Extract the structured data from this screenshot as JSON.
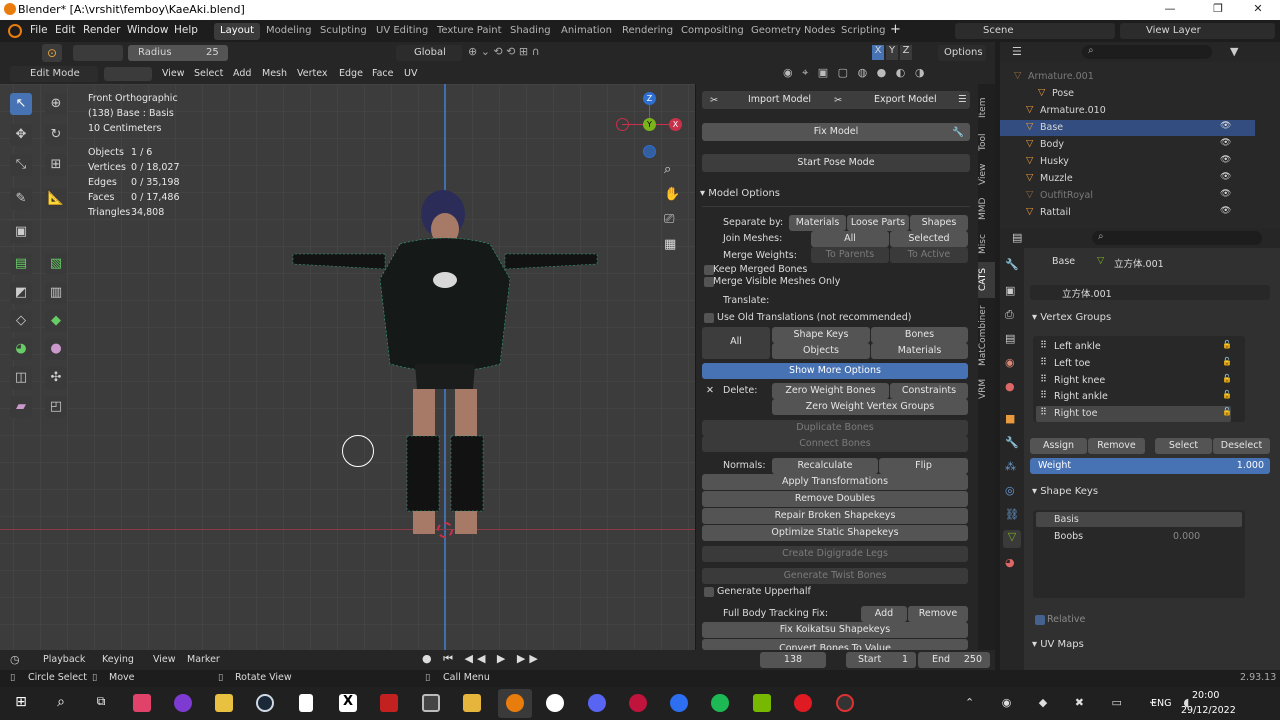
{
  "window": {
    "title": "Blender* [A:\\vrshit\\femboy\\KaeAki.blend]",
    "min_glyph": "—",
    "max_glyph": "❐",
    "close_glyph": "✕"
  },
  "menubar": {
    "menus": [
      "File",
      "Edit",
      "Render",
      "Window",
      "Help"
    ],
    "workspaces": [
      "Layout",
      "Modeling",
      "Sculpting",
      "UV Editing",
      "Texture Paint",
      "Shading",
      "Animation",
      "Rendering",
      "Compositing",
      "Geometry Nodes",
      "Scripting"
    ],
    "scene": "Scene",
    "view_layer": "View Layer",
    "add_glyph": "+"
  },
  "tool_toolbar": {
    "radius_label": "Radius",
    "radius_value": "25",
    "orientation": "Global",
    "options": "Options",
    "x": "X",
    "y": "Y",
    "z": "Z"
  },
  "header": {
    "mode": "Edit Mode",
    "menus": [
      "View",
      "Select",
      "Add",
      "Mesh",
      "Vertex",
      "Edge",
      "Face",
      "UV"
    ]
  },
  "viewport": {
    "view_name": "Front Orthographic",
    "object_info": "(138) Base : Basis",
    "scale": "10 Centimeters",
    "stats": [
      {
        "label": "Objects",
        "value": "1 / 6"
      },
      {
        "label": "Vertices",
        "value": "0 / 18,027"
      },
      {
        "label": "Edges",
        "value": "0 / 35,198"
      },
      {
        "label": "Faces",
        "value": "0 / 17,486"
      },
      {
        "label": "Triangles",
        "value": "34,808"
      }
    ],
    "gizmo": {
      "x": "X",
      "y": "Y",
      "z": "Z"
    }
  },
  "npanel": {
    "import": "Import Model",
    "export": "Export Model",
    "fix": "Fix Model",
    "pose": "Start Pose Mode",
    "model_options": "Model Options",
    "separate_by": "Separate by:",
    "sep_opts": [
      "Materials",
      "Loose Parts",
      "Shapes"
    ],
    "join_meshes": "Join Meshes:",
    "join_all": "All",
    "join_selected": "Selected",
    "merge_weights": "Merge Weights:",
    "to_parents": "To Parents",
    "to_active": "To Active",
    "keep_merged": "Keep Merged Bones",
    "merge_visible": "Merge Visible Meshes Only",
    "translate": "Translate:",
    "old_trans": "Use Old Translations (not recommended)",
    "t_all": "All",
    "t_shape": "Shape Keys",
    "t_bones": "Bones",
    "t_objects": "Objects",
    "t_materials": "Materials",
    "show_more": "Show More Options",
    "delete": "Delete:",
    "zero_bones": "Zero Weight Bones",
    "constraints": "Constraints",
    "zero_vg": "Zero Weight Vertex Groups",
    "dup_bones": "Duplicate Bones",
    "connect_bones": "Connect Bones",
    "normals": "Normals:",
    "recalc": "Recalculate",
    "flip": "Flip",
    "apply_trans": "Apply Transformations",
    "remove_doubles": "Remove Doubles",
    "repair_sk": "Repair Broken Shapekeys",
    "opt_sk": "Optimize Static Shapekeys",
    "digi": "Create Digigrade Legs",
    "twist": "Generate Twist Bones",
    "upperhalf": "Generate Upperhalf",
    "fbt": "Full Body Tracking Fix:",
    "fbt_add": "Add",
    "fbt_remove": "Remove",
    "koikatsu": "Fix Koikatsu Shapekeys",
    "convert_bones": "Convert Bones To Value"
  },
  "ntabs": [
    "Item",
    "Tool",
    "View",
    "MMD",
    "Misc",
    "CATS",
    "MatCombiner",
    "VRM"
  ],
  "outliner": {
    "rows": [
      {
        "name": "Armature.001",
        "indent": 0,
        "dim": true
      },
      {
        "name": "Pose",
        "indent": 2,
        "dim": false
      },
      {
        "name": "Armature.010",
        "indent": 1,
        "dim": false
      },
      {
        "name": "Base",
        "indent": 1,
        "dim": false,
        "selected": true
      },
      {
        "name": "Body",
        "indent": 1,
        "dim": false
      },
      {
        "name": "Husky",
        "indent": 1,
        "dim": false
      },
      {
        "name": "Muzzle",
        "indent": 1,
        "dim": false
      },
      {
        "name": "OutfitRoyal",
        "indent": 1,
        "dim": true
      },
      {
        "name": "Rattail",
        "indent": 1,
        "dim": false
      }
    ]
  },
  "properties": {
    "object": "Base",
    "mesh": "立方体.001",
    "mesh_field": "立方体.001",
    "vertex_groups": "Vertex Groups",
    "vg_items": [
      "Left ankle",
      "Left toe",
      "Right knee",
      "Right ankle",
      "Right toe"
    ],
    "assign": "Assign",
    "remove": "Remove",
    "select": "Select",
    "deselect": "Deselect",
    "weight_label": "Weight",
    "weight_value": "1.000",
    "shape_keys": "Shape Keys",
    "sk_items": [
      {
        "name": "Basis",
        "value": ""
      },
      {
        "name": "Boobs",
        "value": "0.000"
      }
    ],
    "relative": "Relative",
    "uv_maps": "UV Maps"
  },
  "timeline": {
    "menus": [
      "Playback",
      "Keying",
      "View",
      "Marker"
    ],
    "frame": "138",
    "start_label": "Start",
    "start": "1",
    "end_label": "End",
    "end": "250"
  },
  "statusbar": {
    "left": "Circle Select",
    "move": "Move",
    "rotate": "Rotate View",
    "call_menu": "Call Menu",
    "version": "2.93.13"
  },
  "taskbar": {
    "lang": "ENG",
    "time": "20:00",
    "date": "29/12/2022"
  },
  "colors": {
    "accent": "#4772b3",
    "selected_row": "#334d80",
    "x_axis": "#c8314a",
    "y_axis": "#7bb31c",
    "z_axis": "#2e6fd0"
  }
}
